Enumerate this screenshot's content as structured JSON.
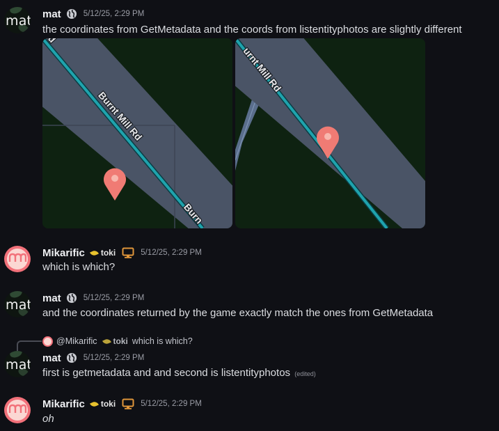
{
  "messages": [
    {
      "username": "mat",
      "avatar_text": "mat",
      "timestamp": "5/12/25, 2:29 PM",
      "text": "the coordinates from GetMetadata and the coords from listentityphotos are slightly different",
      "images": [
        {
          "road_label_main": "Burnt Mill Rd",
          "road_label_corner": "Burn",
          "road_label_top": "d"
        },
        {
          "road_label_main": "urnt Mill Rd"
        }
      ]
    },
    {
      "username": "Mikarific",
      "tag": "toki",
      "timestamp": "5/12/25, 2:29 PM",
      "text": "which is which?"
    },
    {
      "username": "mat",
      "avatar_text": "mat",
      "timestamp": "5/12/25, 2:29 PM",
      "text": "and the coordinates returned by the game exactly match the ones from GetMetadata"
    },
    {
      "reply": {
        "username": "@Mikarific",
        "tag": "toki",
        "text": "which is which?"
      },
      "username": "mat",
      "avatar_text": "mat",
      "timestamp": "5/12/25, 2:29 PM",
      "text": "first is getmetadata and and second is listentityphotos",
      "edited_label": "(edited)"
    },
    {
      "username": "Mikarific",
      "tag": "toki",
      "timestamp": "5/12/25, 2:29 PM",
      "text": "oh"
    }
  ],
  "icons": {
    "globe": "globe-icon",
    "monitor": "monitor-icon",
    "leaf": "leaf-icon",
    "map_pin": "map-pin-icon"
  },
  "colors": {
    "background": "#0f1015",
    "map_land": "#0e2211",
    "map_road": "#4a5466",
    "map_road_center": "#1fa3ad",
    "map_pin": "#f07b74",
    "tag_leaf": "#e8c22e",
    "monitor": "#e0963a"
  }
}
